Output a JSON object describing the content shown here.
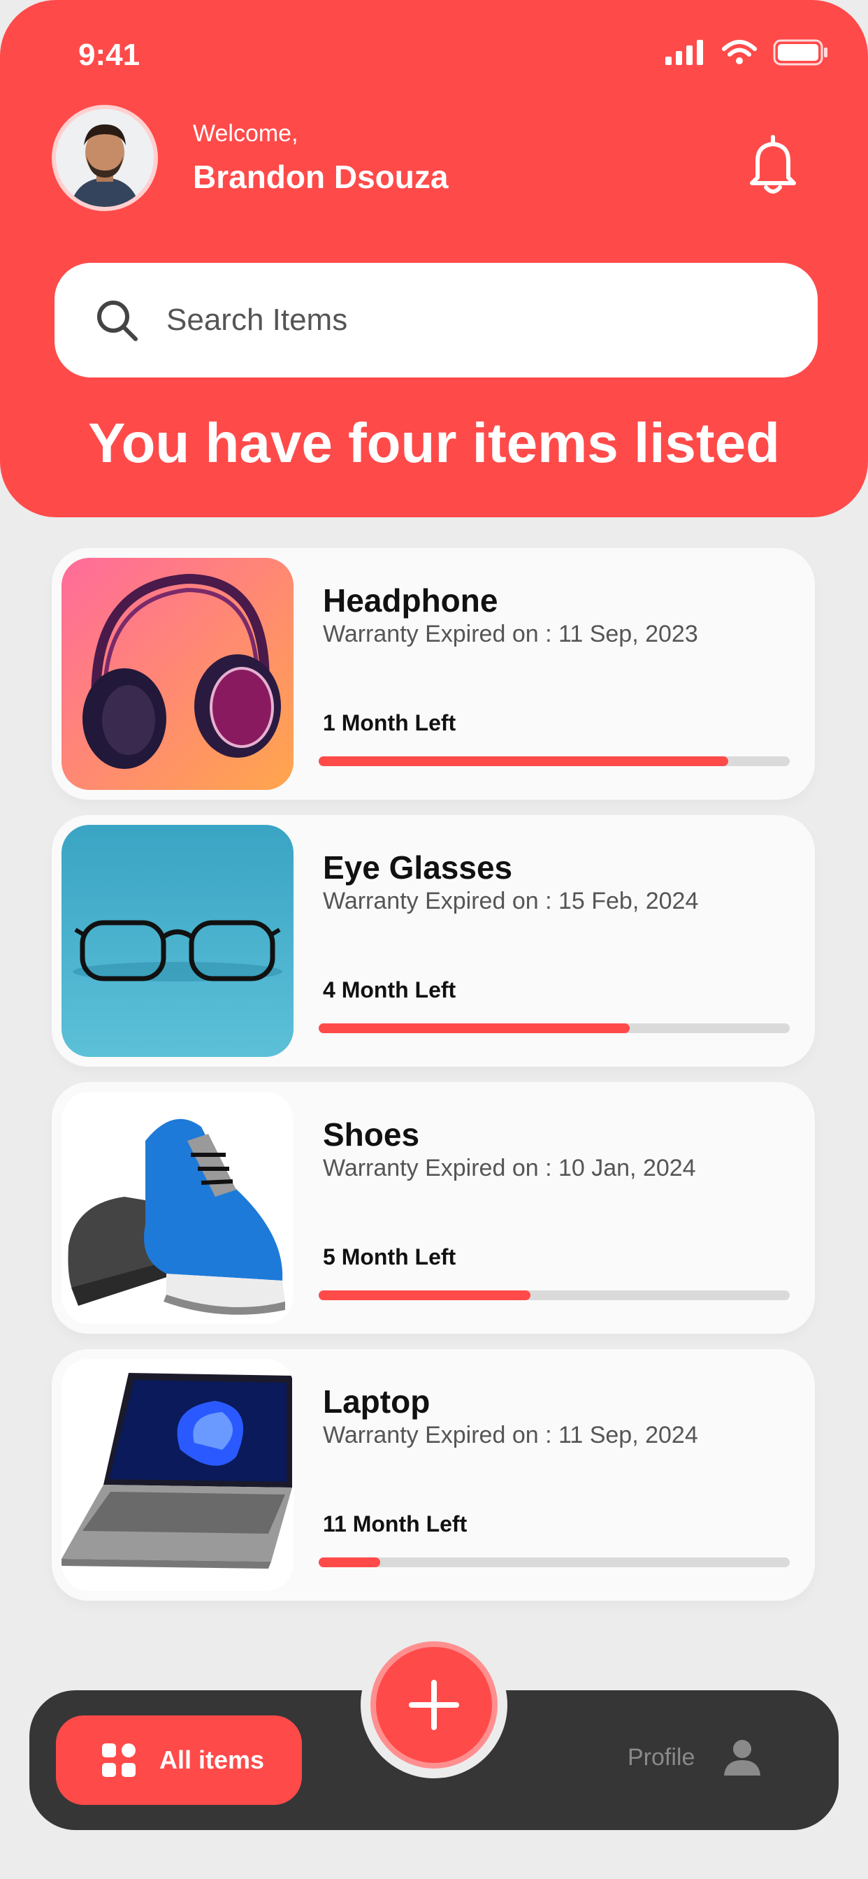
{
  "status_bar": {
    "time": "9:41"
  },
  "header": {
    "welcome": "Welcome,",
    "user_name": "Brandon Dsouza",
    "headline": "You have four items listed"
  },
  "search": {
    "placeholder": "Search Items"
  },
  "items": [
    {
      "title": "Headphone",
      "warranty": "Warranty Expired on : 11 Sep, 2023",
      "left": "1 Month Left",
      "progress": 0.87
    },
    {
      "title": "Eye Glasses",
      "warranty": "Warranty Expired on : 15 Feb, 2024",
      "left": "4 Month Left",
      "progress": 0.66
    },
    {
      "title": "Shoes",
      "warranty": "Warranty Expired on : 10 Jan, 2024",
      "left": "5 Month Left",
      "progress": 0.45
    },
    {
      "title": "Laptop",
      "warranty": "Warranty Expired on : 11 Sep, 2024",
      "left": "11 Month Left",
      "progress": 0.13
    }
  ],
  "bottom_nav": {
    "all_items_label": "All items",
    "profile_label": "Profile"
  },
  "colors": {
    "accent": "#ff4a4a",
    "nav_bg": "#363636",
    "page_bg": "#ececec"
  }
}
